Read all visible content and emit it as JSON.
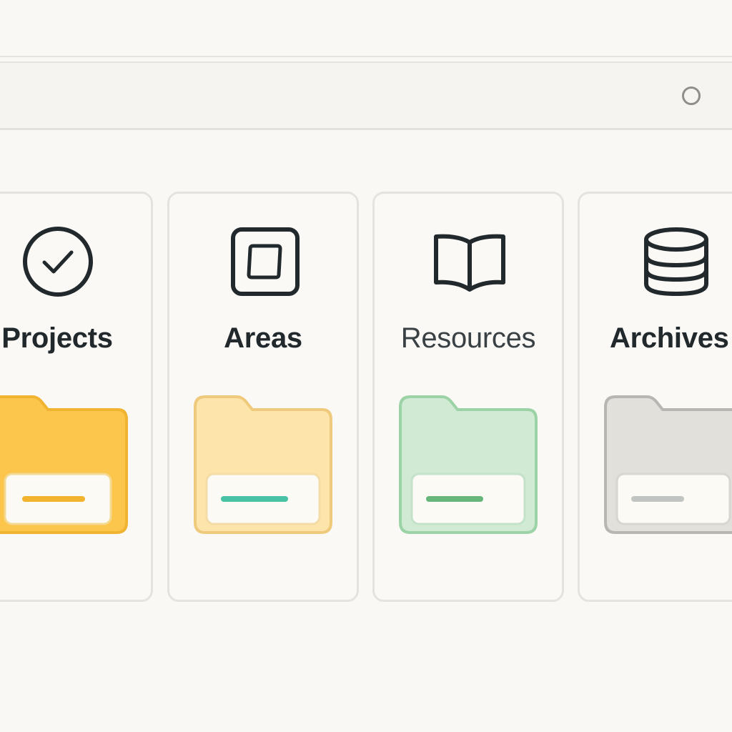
{
  "cards": [
    {
      "title": "Projects",
      "icon": "check-circle-icon",
      "folder_color": "#fcc54c",
      "folder_stroke": "#f0b430",
      "dash_color": "#f2b32e"
    },
    {
      "title": "Areas",
      "icon": "square-frame-icon",
      "folder_color": "#fde4ab",
      "folder_stroke": "#efca7c",
      "dash_color": "#48c2a4"
    },
    {
      "title": "Resources",
      "icon": "open-book-icon",
      "folder_color": "#d0ead3",
      "folder_stroke": "#9cd3a6",
      "dash_color": "#66b57a"
    },
    {
      "title": "Archives",
      "icon": "database-icon",
      "folder_color": "#e1e0db",
      "folder_stroke": "#b7b6b2",
      "dash_color": "#c0c5c1"
    }
  ],
  "colors": {
    "background": "#f9f8f5",
    "icon_stroke": "#22292c",
    "card_border": "#e4e3df"
  }
}
